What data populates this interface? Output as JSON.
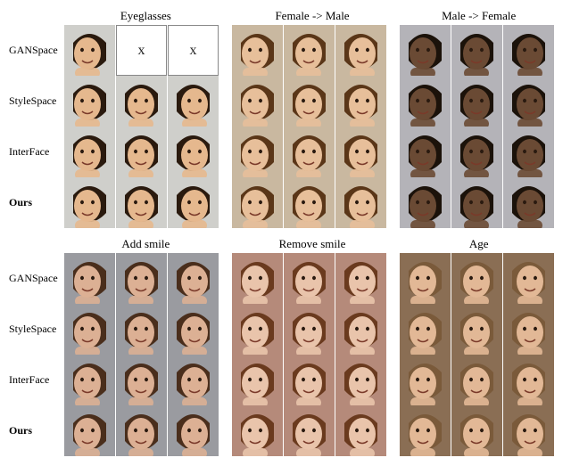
{
  "blocks": [
    {
      "columns": [
        "Eyeglasses",
        "Female -> Male",
        "Male -> Female"
      ],
      "rows": [
        "GANSpace",
        "StyleSpace",
        "InterFace",
        "Ours"
      ],
      "missing": [
        [
          0,
          0,
          1
        ],
        [
          0,
          0,
          2
        ]
      ],
      "faces": [
        {
          "skin": "#e5b88e",
          "hair": "#2a1a0e",
          "bg": "#cfcfcb"
        },
        {
          "skin": "#e7bf9a",
          "hair": "#5a3618",
          "bg": "#c9b8a0"
        },
        {
          "skin": "#6a4a34",
          "hair": "#1b120a",
          "bg": "#b4b3b8"
        }
      ]
    },
    {
      "columns": [
        "Add smile",
        "Remove smile",
        "Age"
      ],
      "rows": [
        "GANSpace",
        "StyleSpace",
        "InterFace",
        "Ours"
      ],
      "missing": [],
      "faces": [
        {
          "skin": "#dcb094",
          "hair": "#4a2e1c",
          "bg": "#9a9ba0"
        },
        {
          "skin": "#e9c4ab",
          "hair": "#6a3a1e",
          "bg": "#b58a7a"
        },
        {
          "skin": "#e2b896",
          "hair": "#7a5a3a",
          "bg": "#8a6e54"
        }
      ]
    }
  ],
  "missing_marker": "x"
}
